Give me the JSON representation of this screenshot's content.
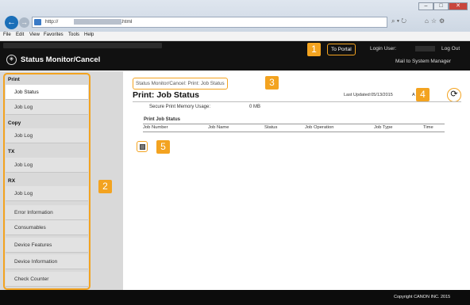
{
  "browser": {
    "address_text": "http://",
    "address_suffix": "/j_plst.html",
    "addr_tools": "⌕ ▾ ↻",
    "nav_icons": "⌂☆⚙",
    "window_buttons": [
      "–",
      "□",
      "✕"
    ],
    "menu": [
      "File",
      "Edit",
      "View",
      "Favorites",
      "Tools",
      "Help"
    ]
  },
  "header": {
    "title": "Status Monitor/Cancel",
    "to_portal": "To Portal",
    "login_user_label": "Login User:",
    "logout": "Log Out",
    "mail_system_manager": "Mail to System Manager"
  },
  "sidebar": {
    "print_label": "Print",
    "print_items": [
      "Job Status",
      "Job Log"
    ],
    "copy_label": "Copy",
    "copy_items": [
      "Job Log"
    ],
    "tx_label": "TX",
    "tx_items": [
      "Job Log"
    ],
    "rx_label": "RX",
    "rx_items": [
      "Job Log"
    ],
    "other_items": [
      "Error Information",
      "Consumables",
      "Device Features",
      "Device Information",
      "Check Counter"
    ]
  },
  "main": {
    "breadcrumb": "Status Monitor/Cancel: Print: Job Status",
    "title": "Print: Job Status",
    "last_updated": "Last Updated:05/13/2015",
    "a_mark": "A",
    "secure_print_label": "Secure Print Memory Usage:",
    "secure_print_value": "0 MB",
    "job_status_label": "Print Job Status",
    "columns": [
      "Job Number",
      "Job Name",
      "Status",
      "Job Operation",
      "Job Type",
      "Time"
    ]
  },
  "callouts": [
    "1",
    "2",
    "3",
    "4",
    "5"
  ],
  "footer": {
    "copyright": "Copyright CANON INC. 2015"
  },
  "colors": {
    "accent": "#f3a320",
    "header": "#111111",
    "sidebar": "#d9d9d9"
  }
}
